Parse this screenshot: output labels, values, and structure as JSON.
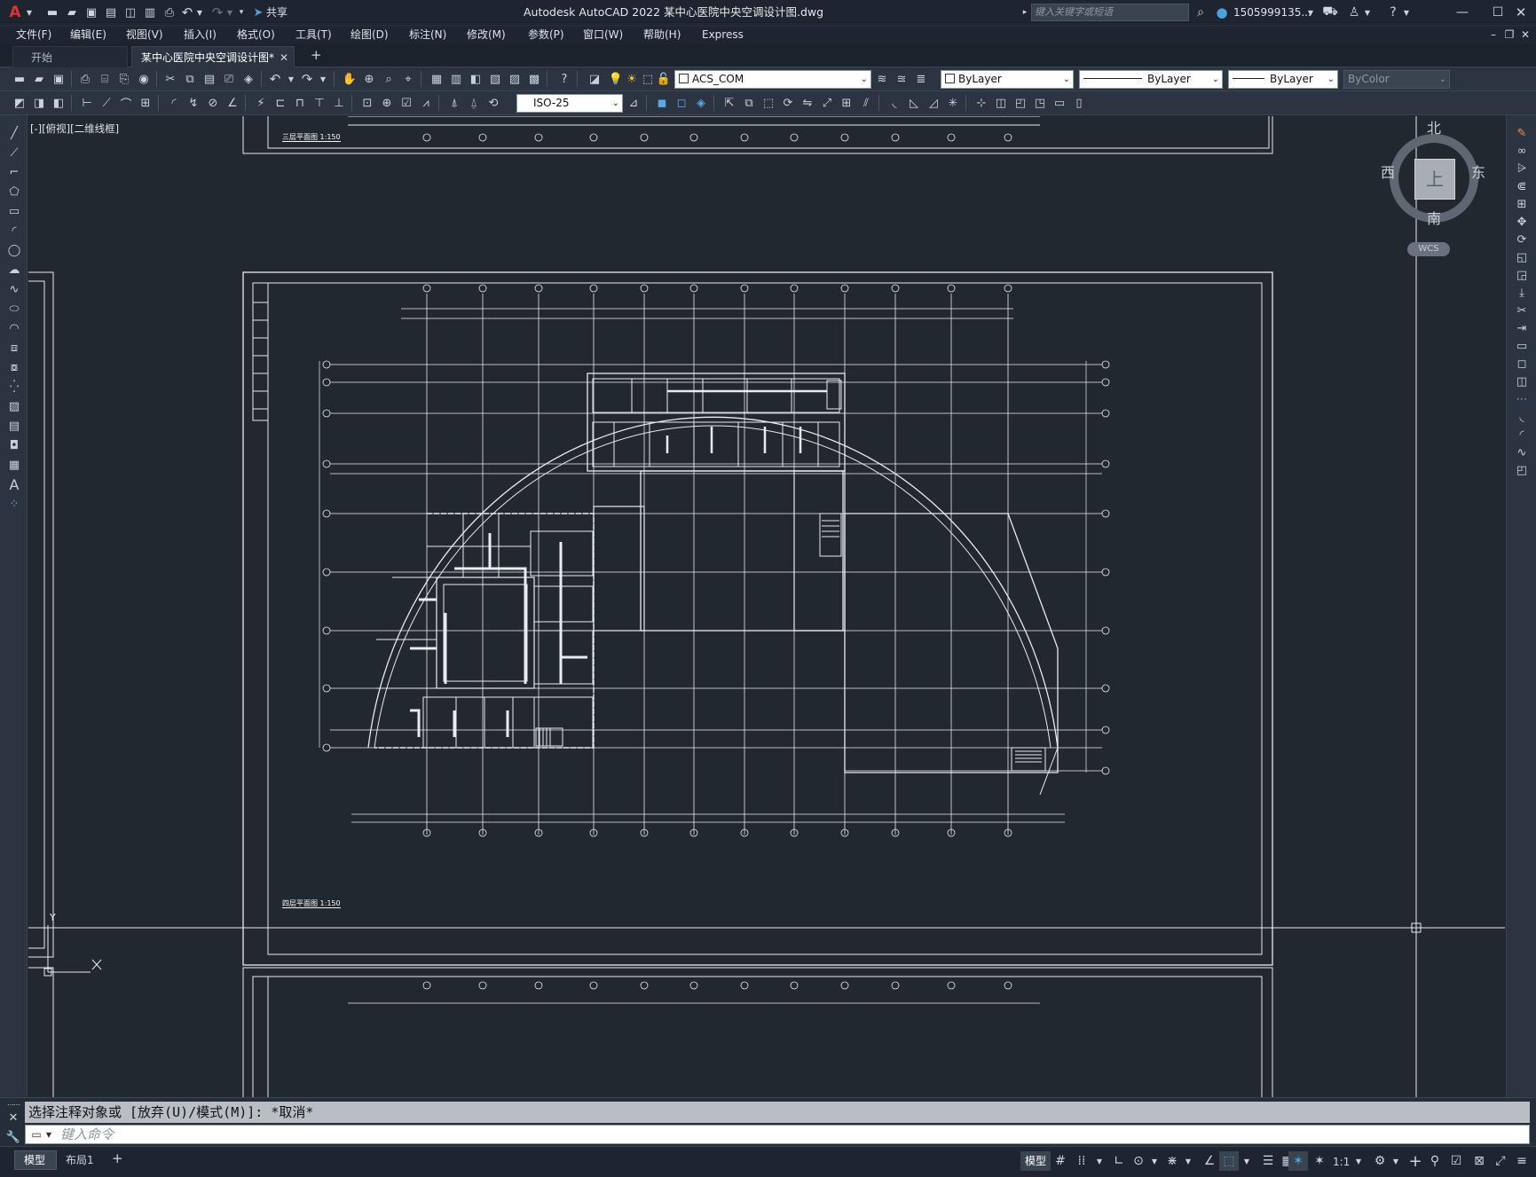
{
  "title": {
    "app_name": "Autodesk AutoCAD 2022",
    "file_name": "某中心医院中央空调设计图.dwg",
    "share_label": "共享",
    "search_placeholder": "键入关键字或短语",
    "user": "1505999135..."
  },
  "menu": [
    "文件(F)",
    "编辑(E)",
    "视图(V)",
    "插入(I)",
    "格式(O)",
    "工具(T)",
    "绘图(D)",
    "标注(N)",
    "修改(M)",
    "参数(P)",
    "窗口(W)",
    "帮助(H)",
    "Express"
  ],
  "tabs": {
    "start": "开始",
    "drawing": "某中心医院中央空调设计图*",
    "add": "+"
  },
  "toolbar": {
    "layer": "ACS_COM",
    "color": "ByLayer",
    "linetype": "ByLayer",
    "lineweight": "ByLayer",
    "plotstyle": "ByColor",
    "dimstyle": "ISO-25"
  },
  "viewport_label": "[-][俯视][二维线框]",
  "viewcube": {
    "north": "北",
    "south": "南",
    "east": "东",
    "west": "西",
    "face": "上",
    "wcs": "WCS"
  },
  "drawing": {
    "upper_plan_title": "三层平面图 1:150",
    "main_plan_title": "四层平面图 1:150"
  },
  "ucs": {
    "x": "X",
    "y": "Y"
  },
  "command": {
    "history": "选择注释对象或 [放弃(U)/模式(M)]: *取消*",
    "prompt_placeholder": "键入命令"
  },
  "status": {
    "model_tab": "模型",
    "layout_tab": "布局1",
    "model_button": "模型",
    "scale": "1:1"
  },
  "accent": "#4aa3df"
}
